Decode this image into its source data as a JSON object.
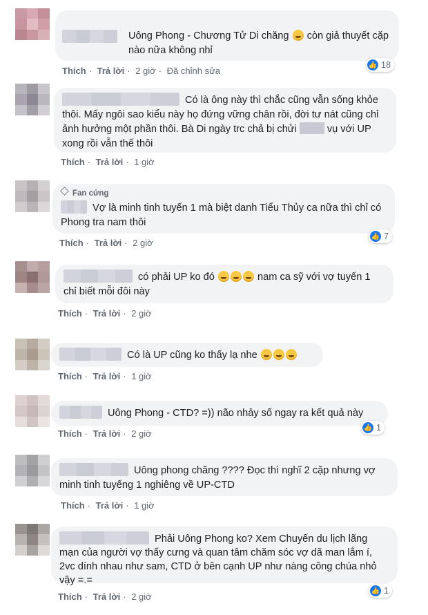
{
  "actions": {
    "like": "Thích",
    "reply": "Trả lời",
    "edited": "Đã chỉnh sửa",
    "fan_badge": "Fan cứng"
  },
  "comments": [
    {
      "text1": "Uông Phong - Chương Tử Di chăng",
      "text2": "còn giả thuyết cặp nào nữa không nhỉ",
      "time": "2 giờ",
      "reactions": "18"
    },
    {
      "text": "Có là ông này thì chắc cũng vẫn sống khỏe thôi. Mấy ngôi sao kiểu này họ đứng vững chân rồi, đời tư nát cũng chỉ ảnh hưởng một phần thôi. Bà Di ngày trc chả bị chửi",
      "text_tail": "vụ với UP xong rồi vẫn thế thôi",
      "time": "1 giờ"
    },
    {
      "text": "Vợ là minh tinh tuyến 1 mà biệt danh Tiểu Thủy ca nữa thì chỉ có Phong tra nam thôi",
      "time": "2 giờ",
      "reactions": "7"
    },
    {
      "text1": "có phải UP ko đó",
      "text2": "nam ca sỹ với vợ tuyến 1 chỉ biết mỗi đôi này",
      "time": "2 giờ"
    },
    {
      "text": "Có là UP cũng ko thấy lạ nhe",
      "time": "1 giờ"
    },
    {
      "text": "Uông Phong - CTD? =)) não nhảy số ngay ra kết quả này",
      "time": "2 giờ",
      "reactions": "1"
    },
    {
      "text": "Uông phong chăng ???? Đọc thì nghĩ 2 cặp nhưng vợ minh tinh tuyếng 1 nghiêng về UP-CTD",
      "time": "1 giờ"
    },
    {
      "text": "Phải Uông Phong ko? Xem Chuyến du lịch lãng mạn của người vợ thấy cưng và quan tâm chăm sóc vợ dã man lắm í, 2vc dính nhau như sam, CTD ở bên cạnh UP như nàng công chúa nhỏ vậy =.=",
      "time": "2 giờ",
      "reactions": "1"
    }
  ]
}
